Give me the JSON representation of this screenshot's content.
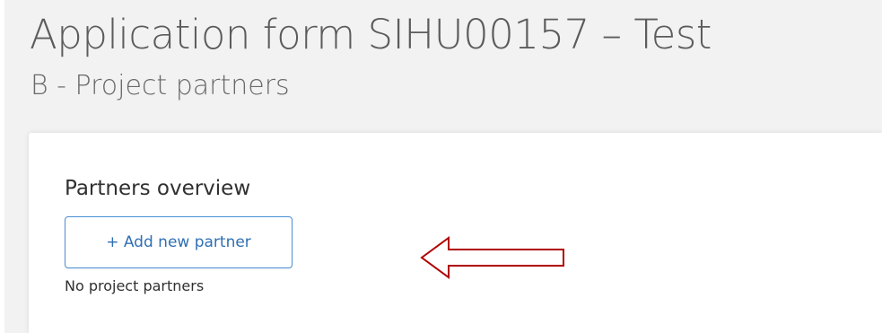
{
  "header": {
    "title": "Application form SIHU00157 – Test",
    "subtitle": "B - Project partners"
  },
  "partners_card": {
    "title": "Partners overview",
    "add_button_label": "+ Add new partner",
    "empty_message": "No project partners"
  },
  "annotation": {
    "arrow_color": "#b00000",
    "arrow_direction": "left"
  },
  "colors": {
    "page_background": "#f2f2f2",
    "card_background": "#ffffff",
    "button_border": "#4a8fd6",
    "button_text": "#2f6fb3"
  }
}
